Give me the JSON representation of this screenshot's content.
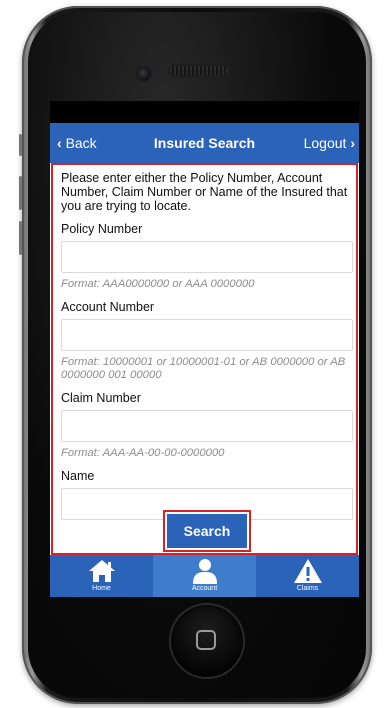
{
  "nav": {
    "back_label": "Back",
    "title": "Insured Search",
    "logout_label": "Logout"
  },
  "form": {
    "intro": "Please enter either the Policy Number, Account Number, Claim Number or Name of the Insured that you are trying to locate.",
    "fields": [
      {
        "label": "Policy Number",
        "value": "",
        "hint": "Format: AAA0000000 or AAA 0000000"
      },
      {
        "label": "Account Number",
        "value": "",
        "hint": "Format: 10000001 or 10000001-01 or AB 0000000 or AB 0000000 001 00000"
      },
      {
        "label": "Claim Number",
        "value": "",
        "hint": "Format: AAA-AA-00-00-0000000"
      },
      {
        "label": "Name",
        "value": ""
      }
    ],
    "search_label": "Search"
  },
  "tabs": [
    {
      "label": "Home",
      "icon": "home-icon"
    },
    {
      "label": "Account",
      "icon": "person-icon",
      "active": true
    },
    {
      "label": "Claims",
      "icon": "warning-icon"
    }
  ],
  "colors": {
    "brand_blue": "#2a63b8",
    "highlight_red": "#d6222a"
  }
}
